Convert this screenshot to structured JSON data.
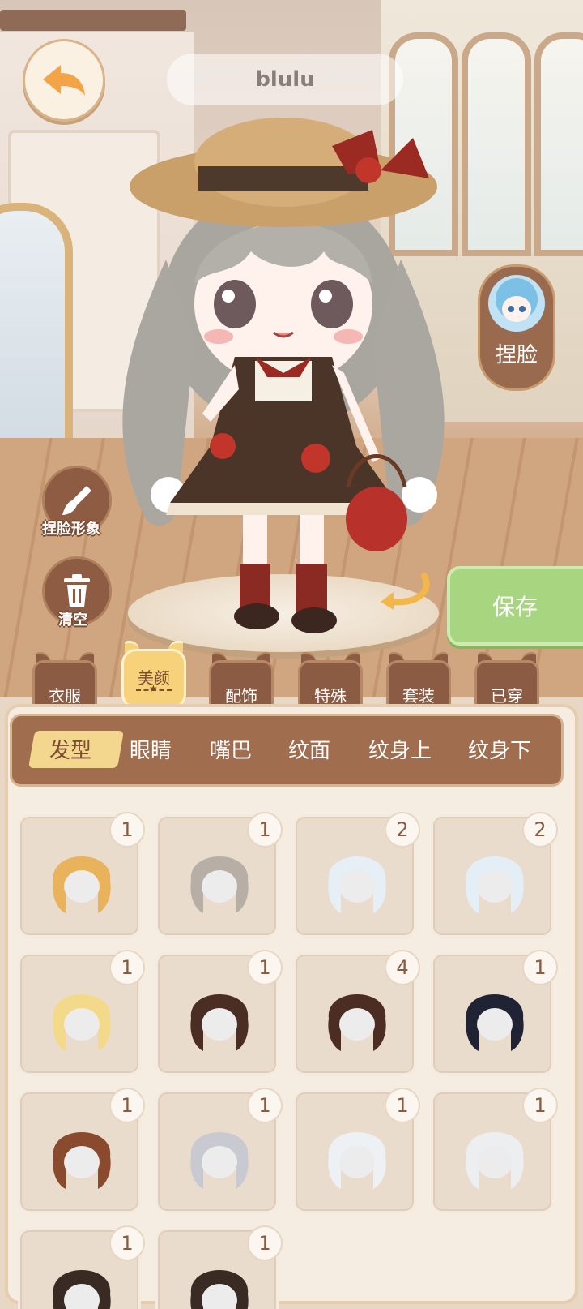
{
  "header": {
    "character_name": "blulu"
  },
  "side": {
    "face_button_label": "捏脸",
    "pinch_face_label": "捏脸形象",
    "clear_label": "清空",
    "save_label": "保存"
  },
  "categories": [
    {
      "label": "衣服",
      "active": false
    },
    {
      "label": "美颜",
      "active": true
    },
    {
      "label": "配饰",
      "active": false
    },
    {
      "label": "特殊",
      "active": false
    },
    {
      "label": "套装",
      "active": false
    },
    {
      "label": "已穿",
      "active": false
    }
  ],
  "subtabs": [
    {
      "label": "发型",
      "active": true
    },
    {
      "label": "眼睛",
      "active": false
    },
    {
      "label": "嘴巴",
      "active": false
    },
    {
      "label": "纹面",
      "active": false
    },
    {
      "label": "纹身上",
      "active": false
    },
    {
      "label": "纹身下",
      "active": false
    }
  ],
  "items": [
    {
      "count": "1",
      "hair_color": "#e8b35a"
    },
    {
      "count": "1",
      "hair_color": "#b7afa6"
    },
    {
      "count": "2",
      "hair_color": "#e6eef6"
    },
    {
      "count": "2",
      "hair_color": "#e4eef7"
    },
    {
      "count": "1",
      "hair_color": "#f3d98a"
    },
    {
      "count": "1",
      "hair_color": "#4a2e24"
    },
    {
      "count": "4",
      "hair_color": "#4b2d22"
    },
    {
      "count": "1",
      "hair_color": "#1f2333"
    },
    {
      "count": "1",
      "hair_color": "#8a4a2e"
    },
    {
      "count": "1",
      "hair_color": "#c9c9d2"
    },
    {
      "count": "1",
      "hair_color": "#eef1f4"
    },
    {
      "count": "1",
      "hair_color": "#eceef0"
    },
    {
      "count": "1",
      "hair_color": "#3a2a24"
    },
    {
      "count": "1",
      "hair_color": "#3a2a24"
    }
  ]
}
